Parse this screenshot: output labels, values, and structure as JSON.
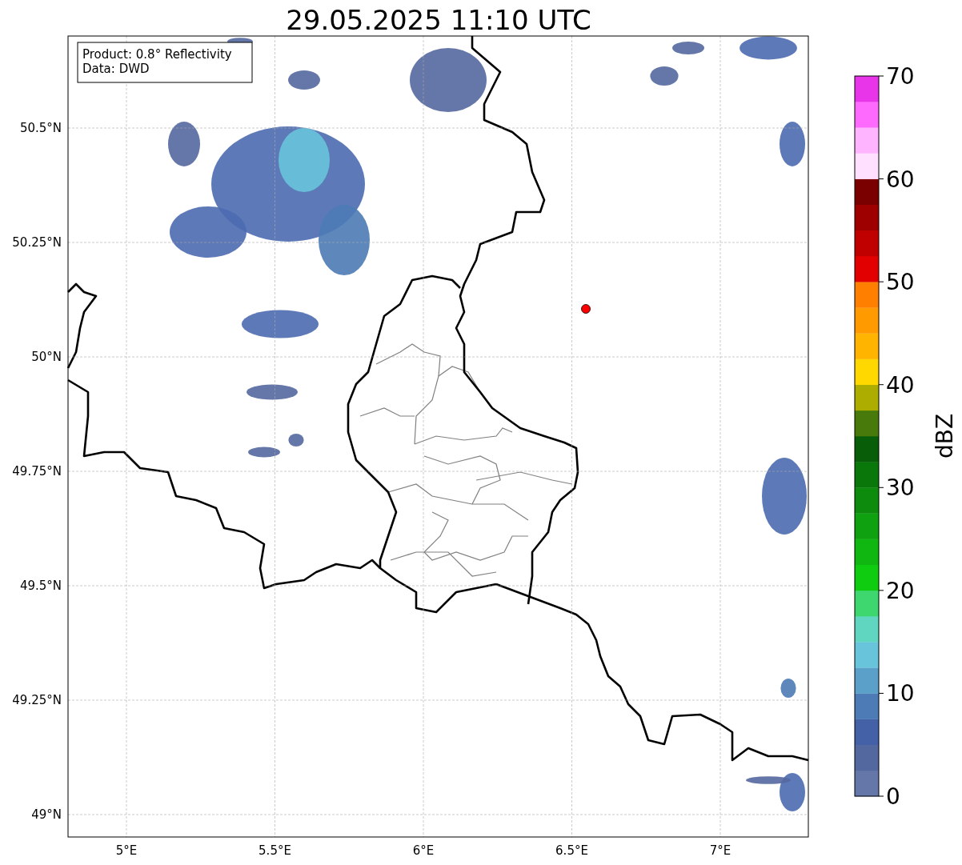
{
  "title": "29.05.2025 11:10 UTC",
  "info_box": [
    "Product: 0.8° Reflectivity",
    "Data: DWD"
  ],
  "y_ticks": [
    "50.5°N",
    "50.25°N",
    "50°N",
    "49.75°N",
    "49.5°N",
    "49.25°N",
    "49°N"
  ],
  "x_ticks": [
    "5°E",
    "5.5°E",
    "6°E",
    "6.5°E",
    "7°E"
  ],
  "colorbar": {
    "label": "dBZ",
    "ticks": [
      "70",
      "60",
      "50",
      "40",
      "30",
      "20",
      "10",
      "0"
    ],
    "segments": [
      {
        "color": "#6577a8"
      },
      {
        "color": "#5468a0"
      },
      {
        "color": "#4461a7"
      },
      {
        "color": "#4c7bb5"
      },
      {
        "color": "#5ba0c8"
      },
      {
        "color": "#68c4db"
      },
      {
        "color": "#60d6c0"
      },
      {
        "color": "#3ed66f"
      },
      {
        "color": "#10cc10"
      },
      {
        "color": "#11b711"
      },
      {
        "color": "#0fa10f"
      },
      {
        "color": "#0d8b0d"
      },
      {
        "color": "#0a770a"
      },
      {
        "color": "#085e08"
      },
      {
        "color": "#477a0a"
      },
      {
        "color": "#adad00"
      },
      {
        "color": "#ffd800"
      },
      {
        "color": "#ffb400"
      },
      {
        "color": "#ff9a00"
      },
      {
        "color": "#ff7f00"
      },
      {
        "color": "#e20000"
      },
      {
        "color": "#c00000"
      },
      {
        "color": "#9e0000"
      },
      {
        "color": "#7a0000"
      },
      {
        "color": "#ffe0ff"
      },
      {
        "color": "#feb4fe"
      },
      {
        "color": "#fd6afd"
      },
      {
        "color": "#e935e9"
      }
    ]
  }
}
